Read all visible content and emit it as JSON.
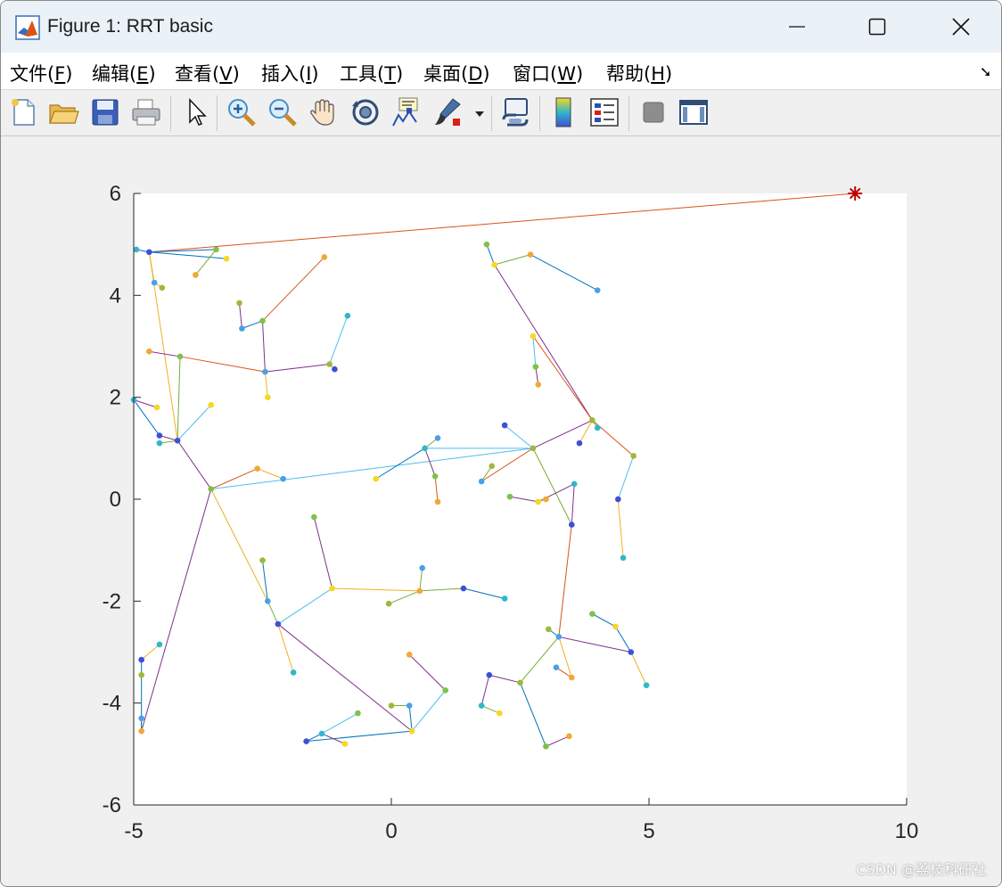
{
  "window": {
    "title": "Figure 1: RRT basic",
    "icons": {
      "app": "matlab-icon",
      "minimize": "minimize-icon",
      "maximize": "maximize-icon",
      "close": "close-icon"
    }
  },
  "menu": [
    {
      "text": "文件(",
      "key": "F",
      "end": ")"
    },
    {
      "text": "编辑(",
      "key": "E",
      "end": ")"
    },
    {
      "text": "查看(",
      "key": "V",
      "end": ")"
    },
    {
      "text": "插入(",
      "key": "I",
      "end": ")"
    },
    {
      "text": "工具(",
      "key": "T",
      "end": ")"
    },
    {
      "text": "桌面(",
      "key": "D",
      "end": ")"
    },
    {
      "text": "窗口(",
      "key": "W",
      "end": ")"
    },
    {
      "text": "帮助(",
      "key": "H",
      "end": ")"
    }
  ],
  "menu_overflow_icon": "dock-arrow-icon",
  "toolbar_icons": [
    "new-figure-icon",
    "open-file-icon",
    "save-icon",
    "print-icon",
    "edit-plot-arrow-icon",
    "zoom-in-icon",
    "zoom-out-icon",
    "pan-hand-icon",
    "rotate-3d-icon",
    "data-cursor-icon",
    "brush-icon",
    "brush-dropdown-icon",
    "link-plot-icon",
    "colorbar-icon",
    "legend-icon",
    "hide-plot-tools-icon",
    "show-plot-tools-icon"
  ],
  "watermark": "CSDN @荔枝科研社",
  "chart_data": {
    "type": "scatter",
    "title": "",
    "xlabel": "",
    "ylabel": "",
    "xlim": [
      -5,
      10
    ],
    "ylim": [
      -6,
      6
    ],
    "xticks": [
      "-5",
      "0",
      "5",
      "10"
    ],
    "yticks": [
      "-6",
      "-4",
      "-2",
      "0",
      "2",
      "4",
      "6"
    ],
    "goal": {
      "x": 9,
      "y": 6,
      "marker": "asterisk",
      "color": "#c00000"
    },
    "tree_edges": [
      {
        "from": [
          -4.7,
          4.85
        ],
        "to": [
          9.0,
          6.0
        ],
        "color": "#d95319"
      },
      {
        "from": [
          -4.95,
          4.9
        ],
        "to": [
          -4.7,
          4.85
        ],
        "color": "#0072bd"
      },
      {
        "from": [
          -4.7,
          4.85
        ],
        "to": [
          -3.2,
          4.72
        ],
        "color": "#0072bd"
      },
      {
        "from": [
          -4.7,
          4.85
        ],
        "to": [
          -3.4,
          4.9
        ],
        "color": "#0072bd"
      },
      {
        "from": [
          -3.4,
          4.9
        ],
        "to": [
          -3.8,
          4.4
        ],
        "color": "#77ac30"
      },
      {
        "from": [
          -4.7,
          4.85
        ],
        "to": [
          -4.6,
          4.25
        ],
        "color": "#edb120"
      },
      {
        "from": [
          -4.6,
          4.25
        ],
        "to": [
          -4.45,
          4.15
        ],
        "color": "#edb120"
      },
      {
        "from": [
          -4.7,
          4.85
        ],
        "to": [
          -4.15,
          1.15
        ],
        "color": "#edb120"
      },
      {
        "from": [
          -4.15,
          1.15
        ],
        "to": [
          -4.5,
          1.1
        ],
        "color": "#77ac30"
      },
      {
        "from": [
          -4.15,
          1.15
        ],
        "to": [
          -3.5,
          1.85
        ],
        "color": "#4dbeee"
      },
      {
        "from": [
          -4.15,
          1.15
        ],
        "to": [
          -4.1,
          2.8
        ],
        "color": "#77ac30"
      },
      {
        "from": [
          -4.1,
          2.8
        ],
        "to": [
          -4.7,
          2.9
        ],
        "color": "#7e2f8e"
      },
      {
        "from": [
          -4.1,
          2.8
        ],
        "to": [
          -2.45,
          2.5
        ],
        "color": "#d95319"
      },
      {
        "from": [
          -2.45,
          2.5
        ],
        "to": [
          -1.2,
          2.65
        ],
        "color": "#7e2f8e"
      },
      {
        "from": [
          -1.2,
          2.65
        ],
        "to": [
          -1.1,
          2.55
        ],
        "color": "#edb120"
      },
      {
        "from": [
          -1.2,
          2.65
        ],
        "to": [
          -0.85,
          3.6
        ],
        "color": "#4dbeee"
      },
      {
        "from": [
          -2.45,
          2.5
        ],
        "to": [
          -2.4,
          2.0
        ],
        "color": "#edb120"
      },
      {
        "from": [
          -2.45,
          2.5
        ],
        "to": [
          -2.5,
          3.5
        ],
        "color": "#7e2f8e"
      },
      {
        "from": [
          -2.5,
          3.5
        ],
        "to": [
          -1.3,
          4.75
        ],
        "color": "#d95319"
      },
      {
        "from": [
          -2.5,
          3.5
        ],
        "to": [
          -2.9,
          3.35
        ],
        "color": "#0072bd"
      },
      {
        "from": [
          -2.9,
          3.35
        ],
        "to": [
          -2.95,
          3.85
        ],
        "color": "#7e2f8e"
      },
      {
        "from": [
          -4.15,
          1.15
        ],
        "to": [
          -4.5,
          1.25
        ],
        "color": "#7e2f8e"
      },
      {
        "from": [
          -4.5,
          1.25
        ],
        "to": [
          -5.0,
          1.95
        ],
        "color": "#0072bd"
      },
      {
        "from": [
          -5.0,
          1.95
        ],
        "to": [
          -4.55,
          1.8
        ],
        "color": "#7e2f8e"
      },
      {
        "from": [
          -4.15,
          1.15
        ],
        "to": [
          -3.5,
          0.2
        ],
        "color": "#7e2f8e"
      },
      {
        "from": [
          -3.5,
          0.2
        ],
        "to": [
          -2.6,
          0.6
        ],
        "color": "#d95319"
      },
      {
        "from": [
          -2.6,
          0.6
        ],
        "to": [
          -2.1,
          0.4
        ],
        "color": "#edb120"
      },
      {
        "from": [
          -3.5,
          0.2
        ],
        "to": [
          2.75,
          1.0
        ],
        "color": "#4dbeee"
      },
      {
        "from": [
          2.75,
          1.0
        ],
        "to": [
          2.2,
          1.45
        ],
        "color": "#4dbeee"
      },
      {
        "from": [
          2.75,
          1.0
        ],
        "to": [
          0.65,
          1.0
        ],
        "color": "#4dbeee"
      },
      {
        "from": [
          0.65,
          1.0
        ],
        "to": [
          -0.3,
          0.4
        ],
        "color": "#0072bd"
      },
      {
        "from": [
          0.65,
          1.0
        ],
        "to": [
          0.85,
          0.45
        ],
        "color": "#7e2f8e"
      },
      {
        "from": [
          0.85,
          0.45
        ],
        "to": [
          0.9,
          -0.05
        ],
        "color": "#d95319"
      },
      {
        "from": [
          0.65,
          1.0
        ],
        "to": [
          0.9,
          1.2
        ],
        "color": "#77ac30"
      },
      {
        "from": [
          2.75,
          1.0
        ],
        "to": [
          3.9,
          1.55
        ],
        "color": "#7e2f8e"
      },
      {
        "from": [
          3.9,
          1.55
        ],
        "to": [
          3.65,
          1.1
        ],
        "color": "#edb120"
      },
      {
        "from": [
          3.9,
          1.55
        ],
        "to": [
          4.0,
          1.4
        ],
        "color": "#77ac30"
      },
      {
        "from": [
          3.9,
          1.55
        ],
        "to": [
          2.0,
          4.6
        ],
        "color": "#7e2f8e"
      },
      {
        "from": [
          2.0,
          4.6
        ],
        "to": [
          1.85,
          5.0
        ],
        "color": "#0072bd"
      },
      {
        "from": [
          2.0,
          4.6
        ],
        "to": [
          2.7,
          4.8
        ],
        "color": "#77ac30"
      },
      {
        "from": [
          2.7,
          4.8
        ],
        "to": [
          4.0,
          4.1
        ],
        "color": "#0072bd"
      },
      {
        "from": [
          3.9,
          1.55
        ],
        "to": [
          4.7,
          0.85
        ],
        "color": "#d95319"
      },
      {
        "from": [
          4.7,
          0.85
        ],
        "to": [
          4.4,
          0.0
        ],
        "color": "#4dbeee"
      },
      {
        "from": [
          4.4,
          0.0
        ],
        "to": [
          4.5,
          -1.15
        ],
        "color": "#edb120"
      },
      {
        "from": [
          3.9,
          1.55
        ],
        "to": [
          2.75,
          3.2
        ],
        "color": "#d95319"
      },
      {
        "from": [
          2.75,
          3.2
        ],
        "to": [
          2.8,
          2.6
        ],
        "color": "#4dbeee"
      },
      {
        "from": [
          2.8,
          2.6
        ],
        "to": [
          2.85,
          2.25
        ],
        "color": "#7e2f8e"
      },
      {
        "from": [
          2.75,
          1.0
        ],
        "to": [
          1.75,
          0.35
        ],
        "color": "#d95319"
      },
      {
        "from": [
          1.75,
          0.35
        ],
        "to": [
          1.95,
          0.65
        ],
        "color": "#77ac30"
      },
      {
        "from": [
          2.75,
          1.0
        ],
        "to": [
          3.5,
          -0.5
        ],
        "color": "#77ac30"
      },
      {
        "from": [
          3.5,
          -0.5
        ],
        "to": [
          3.55,
          0.3
        ],
        "color": "#7e2f8e"
      },
      {
        "from": [
          3.55,
          0.3
        ],
        "to": [
          2.85,
          -0.05
        ],
        "color": "#7e2f8e"
      },
      {
        "from": [
          2.85,
          -0.05
        ],
        "to": [
          2.3,
          0.05
        ],
        "color": "#7e2f8e"
      },
      {
        "from": [
          2.85,
          -0.05
        ],
        "to": [
          3.0,
          0.0
        ],
        "color": "#edb120"
      },
      {
        "from": [
          3.5,
          -0.5
        ],
        "to": [
          3.25,
          -2.7
        ],
        "color": "#d95319"
      },
      {
        "from": [
          3.25,
          -2.7
        ],
        "to": [
          3.05,
          -2.55
        ],
        "color": "#0072bd"
      },
      {
        "from": [
          3.25,
          -2.7
        ],
        "to": [
          4.65,
          -3.0
        ],
        "color": "#7e2f8e"
      },
      {
        "from": [
          4.65,
          -3.0
        ],
        "to": [
          4.95,
          -3.65
        ],
        "color": "#edb120"
      },
      {
        "from": [
          4.65,
          -3.0
        ],
        "to": [
          4.35,
          -2.5
        ],
        "color": "#0072bd"
      },
      {
        "from": [
          4.35,
          -2.5
        ],
        "to": [
          3.9,
          -2.25
        ],
        "color": "#0072bd"
      },
      {
        "from": [
          3.25,
          -2.7
        ],
        "to": [
          3.5,
          -3.5
        ],
        "color": "#edb120"
      },
      {
        "from": [
          3.5,
          -3.5
        ],
        "to": [
          3.2,
          -3.3
        ],
        "color": "#d95319"
      },
      {
        "from": [
          3.25,
          -2.7
        ],
        "to": [
          2.5,
          -3.6
        ],
        "color": "#77ac30"
      },
      {
        "from": [
          2.5,
          -3.6
        ],
        "to": [
          1.9,
          -3.45
        ],
        "color": "#7e2f8e"
      },
      {
        "from": [
          1.9,
          -3.45
        ],
        "to": [
          1.75,
          -4.05
        ],
        "color": "#7e2f8e"
      },
      {
        "from": [
          1.75,
          -4.05
        ],
        "to": [
          2.1,
          -4.2
        ],
        "color": "#77ac30"
      },
      {
        "from": [
          2.5,
          -3.6
        ],
        "to": [
          3.0,
          -4.85
        ],
        "color": "#0072bd"
      },
      {
        "from": [
          3.0,
          -4.85
        ],
        "to": [
          3.45,
          -4.65
        ],
        "color": "#7e2f8e"
      },
      {
        "from": [
          -3.5,
          0.2
        ],
        "to": [
          -2.4,
          -2.0
        ],
        "color": "#edb120"
      },
      {
        "from": [
          -2.4,
          -2.0
        ],
        "to": [
          -2.5,
          -1.2
        ],
        "color": "#0072bd"
      },
      {
        "from": [
          -2.4,
          -2.0
        ],
        "to": [
          -2.2,
          -2.45
        ],
        "color": "#77ac30"
      },
      {
        "from": [
          -2.2,
          -2.45
        ],
        "to": [
          -1.9,
          -3.4
        ],
        "color": "#edb120"
      },
      {
        "from": [
          -2.2,
          -2.45
        ],
        "to": [
          -1.15,
          -1.75
        ],
        "color": "#4dbeee"
      },
      {
        "from": [
          -1.15,
          -1.75
        ],
        "to": [
          -1.5,
          -0.35
        ],
        "color": "#7e2f8e"
      },
      {
        "from": [
          -1.15,
          -1.75
        ],
        "to": [
          0.55,
          -1.8
        ],
        "color": "#edb120"
      },
      {
        "from": [
          0.55,
          -1.8
        ],
        "to": [
          0.6,
          -1.35
        ],
        "color": "#77ac30"
      },
      {
        "from": [
          0.55,
          -1.8
        ],
        "to": [
          -0.05,
          -2.05
        ],
        "color": "#77ac30"
      },
      {
        "from": [
          0.55,
          -1.8
        ],
        "to": [
          1.4,
          -1.75
        ],
        "color": "#77ac30"
      },
      {
        "from": [
          1.4,
          -1.75
        ],
        "to": [
          2.2,
          -1.95
        ],
        "color": "#0072bd"
      },
      {
        "from": [
          -2.2,
          -2.45
        ],
        "to": [
          0.4,
          -4.55
        ],
        "color": "#7e2f8e"
      },
      {
        "from": [
          0.4,
          -4.55
        ],
        "to": [
          1.05,
          -3.75
        ],
        "color": "#4dbeee"
      },
      {
        "from": [
          1.05,
          -3.75
        ],
        "to": [
          0.35,
          -3.05
        ],
        "color": "#7e2f8e"
      },
      {
        "from": [
          0.4,
          -4.55
        ],
        "to": [
          0.35,
          -4.05
        ],
        "color": "#0072bd"
      },
      {
        "from": [
          0.35,
          -4.05
        ],
        "to": [
          0.0,
          -4.05
        ],
        "color": "#77ac30"
      },
      {
        "from": [
          0.4,
          -4.55
        ],
        "to": [
          -1.65,
          -4.75
        ],
        "color": "#0072bd"
      },
      {
        "from": [
          -1.65,
          -4.75
        ],
        "to": [
          -1.35,
          -4.6
        ],
        "color": "#0072bd"
      },
      {
        "from": [
          -1.35,
          -4.6
        ],
        "to": [
          -0.9,
          -4.8
        ],
        "color": "#7e2f8e"
      },
      {
        "from": [
          -1.35,
          -4.6
        ],
        "to": [
          -0.65,
          -4.2
        ],
        "color": "#4dbeee"
      },
      {
        "from": [
          -3.5,
          0.2
        ],
        "to": [
          -4.85,
          -4.55
        ],
        "color": "#7e2f8e"
      },
      {
        "from": [
          -4.85,
          -4.55
        ],
        "to": [
          -4.85,
          -4.3
        ],
        "color": "#4dbeee"
      },
      {
        "from": [
          -4.85,
          -4.55
        ],
        "to": [
          -4.85,
          -3.45
        ],
        "color": "#0072bd"
      },
      {
        "from": [
          -4.85,
          -3.45
        ],
        "to": [
          -4.85,
          -3.15
        ],
        "color": "#0072bd"
      },
      {
        "from": [
          -4.85,
          -3.15
        ],
        "to": [
          -4.5,
          -2.85
        ],
        "color": "#edb120"
      }
    ],
    "node_colors": [
      "#3e4fd9",
      "#2fb8c9",
      "#f7d722",
      "#7dc24a",
      "#f0a836",
      "#4aa0e8",
      "#9fb83a"
    ]
  }
}
